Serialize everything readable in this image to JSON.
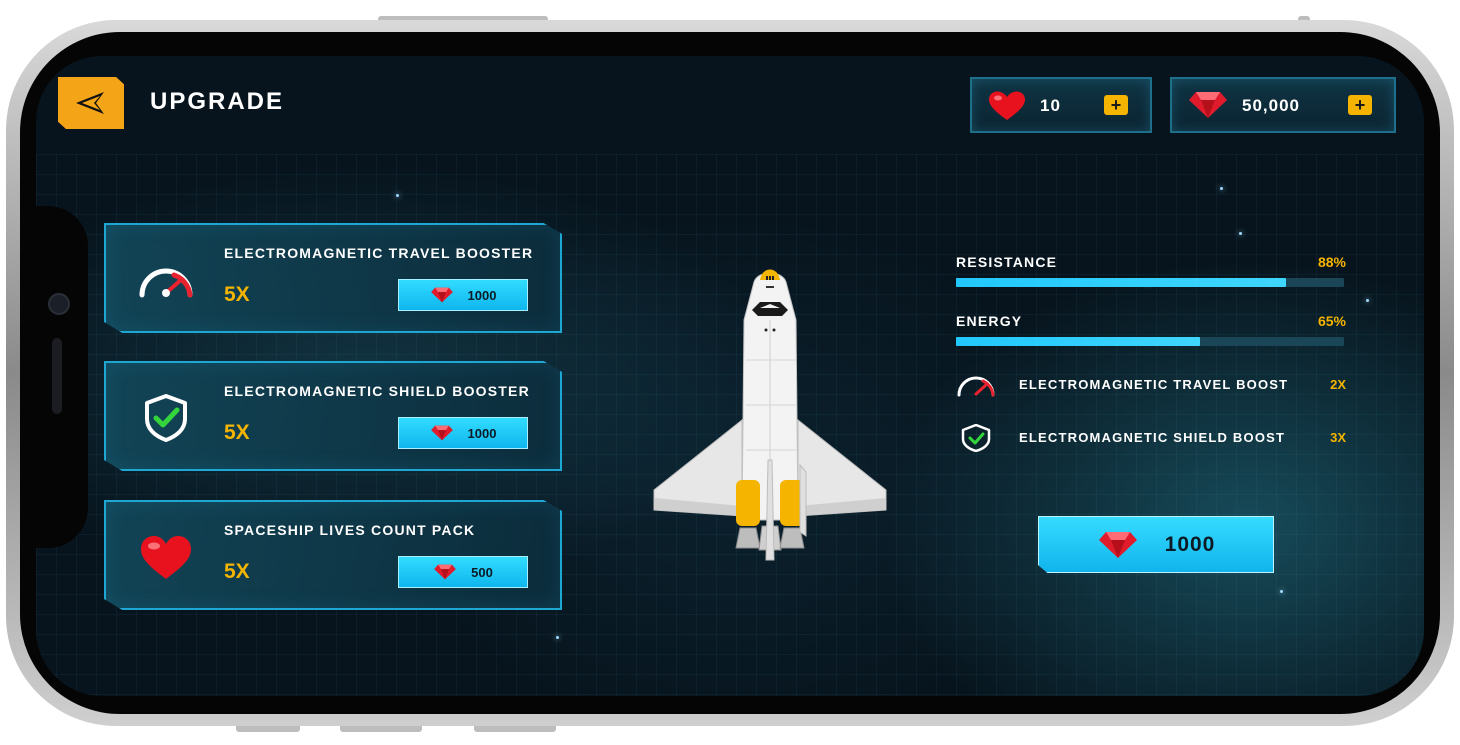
{
  "header": {
    "title": "UPGRADE"
  },
  "wallet": {
    "lives": "10",
    "gems": "50,000",
    "plus_label": "+"
  },
  "upgrades": [
    {
      "title": "ELECTROMAGNETIC TRAVEL BOOSTER",
      "multiplier": "5X",
      "price": "1000",
      "icon": "speedometer-icon"
    },
    {
      "title": "ELECTROMAGNETIC SHIELD BOOSTER",
      "multiplier": "5X",
      "price": "1000",
      "icon": "shield-check-icon"
    },
    {
      "title": "SPACESHIP LIVES COUNT PACK",
      "multiplier": "5X",
      "price": "500",
      "icon": "heart-icon"
    }
  ],
  "stats": [
    {
      "label": "RESISTANCE",
      "value": "88%",
      "fraction": 0.85
    },
    {
      "label": "ENERGY",
      "value": "65%",
      "fraction": 0.63
    }
  ],
  "boosts": [
    {
      "label": "ELECTROMAGNETIC TRAVEL BOOST",
      "value": "2X",
      "icon": "speedometer-icon"
    },
    {
      "label": "ELECTROMAGNETIC SHIELD BOOST",
      "value": "3X",
      "icon": "shield-check-icon"
    }
  ],
  "buy": {
    "price": "1000"
  },
  "colors": {
    "accent": "#f4b400",
    "cyan": "#21c8ff",
    "background": "#07141d"
  }
}
